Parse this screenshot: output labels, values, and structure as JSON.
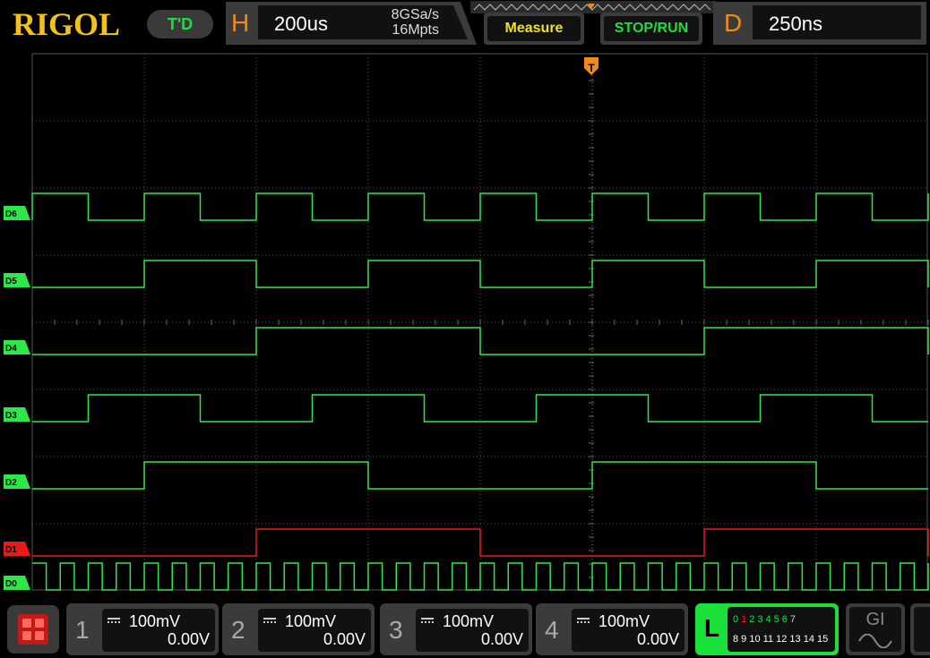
{
  "brand": {
    "logo": "RIGOL"
  },
  "header": {
    "trigger_mode": "T'D",
    "horizontal": {
      "letter": "H",
      "timebase": "200us",
      "sample_rate": "8GSa/s",
      "memory_depth": "16Mpts"
    },
    "measure_label": "Measure",
    "stoprun_label": "STOP/RUN",
    "delay": {
      "letter": "D",
      "value": "250ns"
    }
  },
  "colors": {
    "grid": "#555555",
    "digital_trace": "#2ee84a",
    "selected_trace": "#e81a1a",
    "trigger": "#f28a19",
    "brand": "#f2c21b"
  },
  "trigger_marker": "T",
  "chart_data": {
    "type": "line",
    "title": "",
    "xlabel": "",
    "ylabel": "",
    "grid": true,
    "x_divisions": 16,
    "note_x_unit": "divisions of horizontal grid (200us/div)",
    "series": [
      {
        "name": "D6",
        "color": "#2ee84a",
        "transitions": [
          0,
          1,
          2,
          3,
          4,
          5,
          6,
          7,
          8,
          9,
          10,
          11,
          12,
          13,
          14,
          15,
          16
        ],
        "start_level": 0
      },
      {
        "name": "D5",
        "color": "#2ee84a",
        "transitions": [
          2,
          4,
          6,
          8,
          10,
          12,
          14,
          16
        ],
        "start_level": 0
      },
      {
        "name": "D4",
        "color": "#2ee84a",
        "transitions": [
          4,
          8,
          12,
          16
        ],
        "start_level": 0
      },
      {
        "name": "D3",
        "color": "#2ee84a",
        "transitions": [
          1,
          3,
          5,
          7,
          9,
          11,
          13,
          15
        ],
        "start_level": 0
      },
      {
        "name": "D2",
        "color": "#2ee84a",
        "transitions": [
          2,
          6,
          10,
          14
        ],
        "start_level": 0
      },
      {
        "name": "D1",
        "color": "#e81a1a",
        "transitions": [
          4,
          8,
          12,
          16
        ],
        "start_level": 0
      },
      {
        "name": "D0",
        "color": "#2ee84a",
        "period_div": 0.5,
        "duty": 0.5,
        "start_level": 1
      }
    ]
  },
  "channels": [
    {
      "num": "1",
      "scale": "100mV",
      "offset": "0.00V"
    },
    {
      "num": "2",
      "scale": "100mV",
      "offset": "0.00V"
    },
    {
      "num": "3",
      "scale": "100mV",
      "offset": "0.00V"
    },
    {
      "num": "4",
      "scale": "100mV",
      "offset": "0.00V"
    }
  ],
  "logic": {
    "letter": "L",
    "row1": [
      {
        "label": "0",
        "color": "#19e13a"
      },
      {
        "label": "1",
        "color": "#e81a1a"
      },
      {
        "label": "2",
        "color": "#19e13a"
      },
      {
        "label": "3",
        "color": "#19e13a"
      },
      {
        "label": "4",
        "color": "#19e13a"
      },
      {
        "label": "5",
        "color": "#19e13a"
      },
      {
        "label": "6",
        "color": "#19e13a"
      },
      {
        "label": "7",
        "color": "#cccccc"
      }
    ],
    "row2": "8 9 10 11 12 13 14 15"
  },
  "generator": {
    "label": "GI"
  }
}
